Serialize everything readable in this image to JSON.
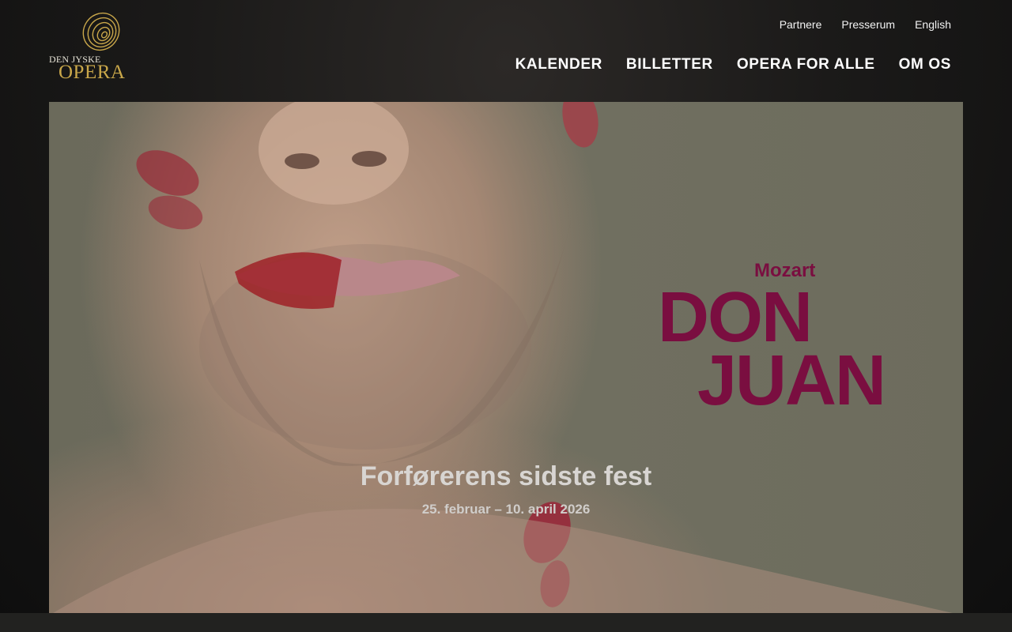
{
  "brand": {
    "line1": "DEN JYSKE",
    "line2": "OPERA",
    "colors": {
      "gold": "#c9a74a",
      "wine": "#7a0e40"
    }
  },
  "utility_nav": [
    {
      "label": "Partnere"
    },
    {
      "label": "Presserum"
    },
    {
      "label": "English"
    }
  ],
  "main_nav": [
    {
      "label": "KALENDER"
    },
    {
      "label": "BILLETTER"
    },
    {
      "label": "OPERA FOR ALLE"
    },
    {
      "label": "OM OS"
    }
  ],
  "hero": {
    "composer": "Mozart",
    "title_line1": "DON",
    "title_line2": "JUAN",
    "headline": "Forførerens sidste fest",
    "dates": "25. februar – 10. april 2026"
  }
}
